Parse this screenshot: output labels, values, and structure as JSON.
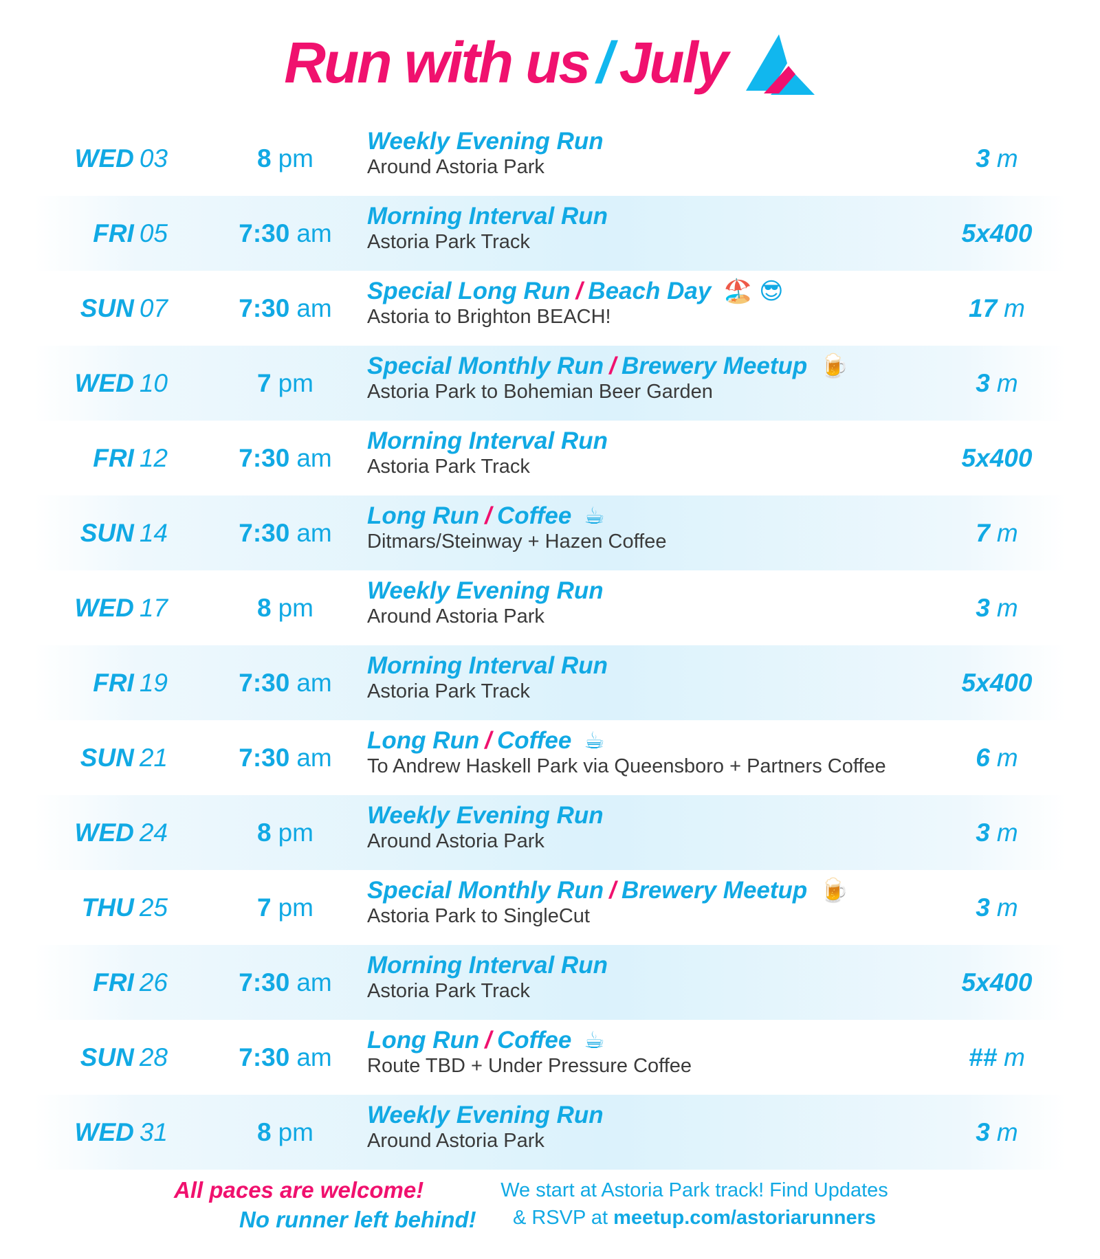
{
  "header": {
    "title_main": "Run with us",
    "title_slash": "/",
    "title_month": "July",
    "logo_icon": "triangle-logo-icon"
  },
  "colors": {
    "pink": "#f0116e",
    "blue": "#11a9e4",
    "text": "#3a3a3a"
  },
  "rows": [
    {
      "dow": "WED",
      "date": "03",
      "time_num": "8",
      "time_ampm": "pm",
      "title_a": "Weekly Evening Run",
      "title_sep": "",
      "title_b": "",
      "emoji": "",
      "location": "Around Astoria Park",
      "dist_num": "3",
      "dist_unit": "m"
    },
    {
      "dow": "FRI",
      "date": "05",
      "time_num": "7:30",
      "time_ampm": "am",
      "title_a": "Morning Interval Run",
      "title_sep": "",
      "title_b": "",
      "emoji": "",
      "location": "Astoria Park Track",
      "dist_num": "5x400",
      "dist_unit": ""
    },
    {
      "dow": "SUN",
      "date": "07",
      "time_num": "7:30",
      "time_ampm": "am",
      "title_a": "Special Long Run",
      "title_sep": "/",
      "title_b": "Beach Day",
      "emoji": "🏖️  😎",
      "location": "Astoria to Brighton BEACH!",
      "dist_num": "17",
      "dist_unit": "m"
    },
    {
      "dow": "WED",
      "date": "10",
      "time_num": "7",
      "time_ampm": "pm",
      "title_a": "Special Monthly Run",
      "title_sep": "/",
      "title_b": "Brewery Meetup",
      "emoji": "🍺",
      "location": "Astoria Park to Bohemian Beer Garden",
      "dist_num": "3",
      "dist_unit": "m"
    },
    {
      "dow": "FRI",
      "date": "12",
      "time_num": "7:30",
      "time_ampm": "am",
      "title_a": "Morning Interval Run",
      "title_sep": "",
      "title_b": "",
      "emoji": "",
      "location": "Astoria Park Track",
      "dist_num": "5x400",
      "dist_unit": ""
    },
    {
      "dow": "SUN",
      "date": "14",
      "time_num": "7:30",
      "time_ampm": "am",
      "title_a": "Long Run",
      "title_sep": "/",
      "title_b": "Coffee",
      "emoji": "☕",
      "location": "Ditmars/Steinway + Hazen Coffee",
      "dist_num": "7",
      "dist_unit": "m"
    },
    {
      "dow": "WED",
      "date": "17",
      "time_num": "8",
      "time_ampm": "pm",
      "title_a": "Weekly Evening Run",
      "title_sep": "",
      "title_b": "",
      "emoji": "",
      "location": "Around Astoria Park",
      "dist_num": "3",
      "dist_unit": "m"
    },
    {
      "dow": "FRI",
      "date": "19",
      "time_num": "7:30",
      "time_ampm": "am",
      "title_a": "Morning Interval Run",
      "title_sep": "",
      "title_b": "",
      "emoji": "",
      "location": "Astoria Park Track",
      "dist_num": "5x400",
      "dist_unit": ""
    },
    {
      "dow": "SUN",
      "date": "21",
      "time_num": "7:30",
      "time_ampm": "am",
      "title_a": "Long Run",
      "title_sep": "/",
      "title_b": "Coffee",
      "emoji": "☕",
      "location": "To Andrew Haskell Park via Queensboro + Partners Coffee",
      "dist_num": "6",
      "dist_unit": "m"
    },
    {
      "dow": "WED",
      "date": "24",
      "time_num": "8",
      "time_ampm": "pm",
      "title_a": "Weekly Evening Run",
      "title_sep": "",
      "title_b": "",
      "emoji": "",
      "location": "Around Astoria Park",
      "dist_num": "3",
      "dist_unit": "m"
    },
    {
      "dow": "THU",
      "date": "25",
      "time_num": "7",
      "time_ampm": "pm",
      "title_a": "Special Monthly Run",
      "title_sep": "/",
      "title_b": "Brewery Meetup",
      "emoji": "🍺",
      "location": "Astoria Park to SingleCut",
      "dist_num": "3",
      "dist_unit": "m"
    },
    {
      "dow": "FRI",
      "date": "26",
      "time_num": "7:30",
      "time_ampm": "am",
      "title_a": "Morning Interval Run",
      "title_sep": "",
      "title_b": "",
      "emoji": "",
      "location": "Astoria Park Track",
      "dist_num": "5x400",
      "dist_unit": ""
    },
    {
      "dow": "SUN",
      "date": "28",
      "time_num": "7:30",
      "time_ampm": "am",
      "title_a": "Long Run",
      "title_sep": "/",
      "title_b": "Coffee",
      "emoji": "☕",
      "location": "Route TBD + Under Pressure Coffee",
      "dist_num": "##",
      "dist_unit": "m"
    },
    {
      "dow": "WED",
      "date": "31",
      "time_num": "8",
      "time_ampm": "pm",
      "title_a": "Weekly Evening Run",
      "title_sep": "",
      "title_b": "",
      "emoji": "",
      "location": "Around Astoria Park",
      "dist_num": "3",
      "dist_unit": "m"
    }
  ],
  "footer": {
    "tagline_1": "All paces are welcome!",
    "tagline_2": "No runner left behind!",
    "info_1": "We start at Astoria Park track! Find Updates",
    "info_2_prefix": "& RSVP at",
    "info_2_link": "meetup.com/astoriarunners"
  }
}
